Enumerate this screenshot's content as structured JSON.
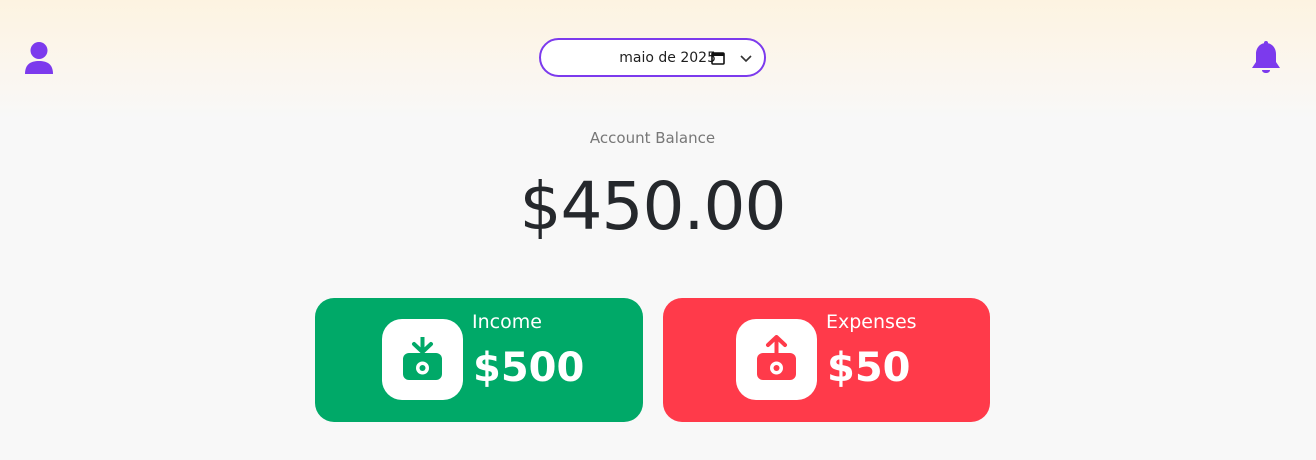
{
  "header": {
    "month_value": "maio de 2025",
    "user_icon": "user-icon",
    "notification_icon": "bell-icon",
    "calendar_icon": "calendar-icon",
    "dropdown_icon": "chevron-down-icon"
  },
  "balance": {
    "label": "Account Balance",
    "amount": "$450.00"
  },
  "cards": {
    "income": {
      "label": "Income",
      "amount": "$500",
      "icon": "money-in-icon",
      "color": "#00a968"
    },
    "expense": {
      "label": "Expenses",
      "amount": "$50",
      "icon": "money-out-icon",
      "color": "#ff3a4a"
    }
  },
  "colors": {
    "accent": "#7c3aed",
    "background": "#f8f8f8",
    "text": "#25282c"
  }
}
